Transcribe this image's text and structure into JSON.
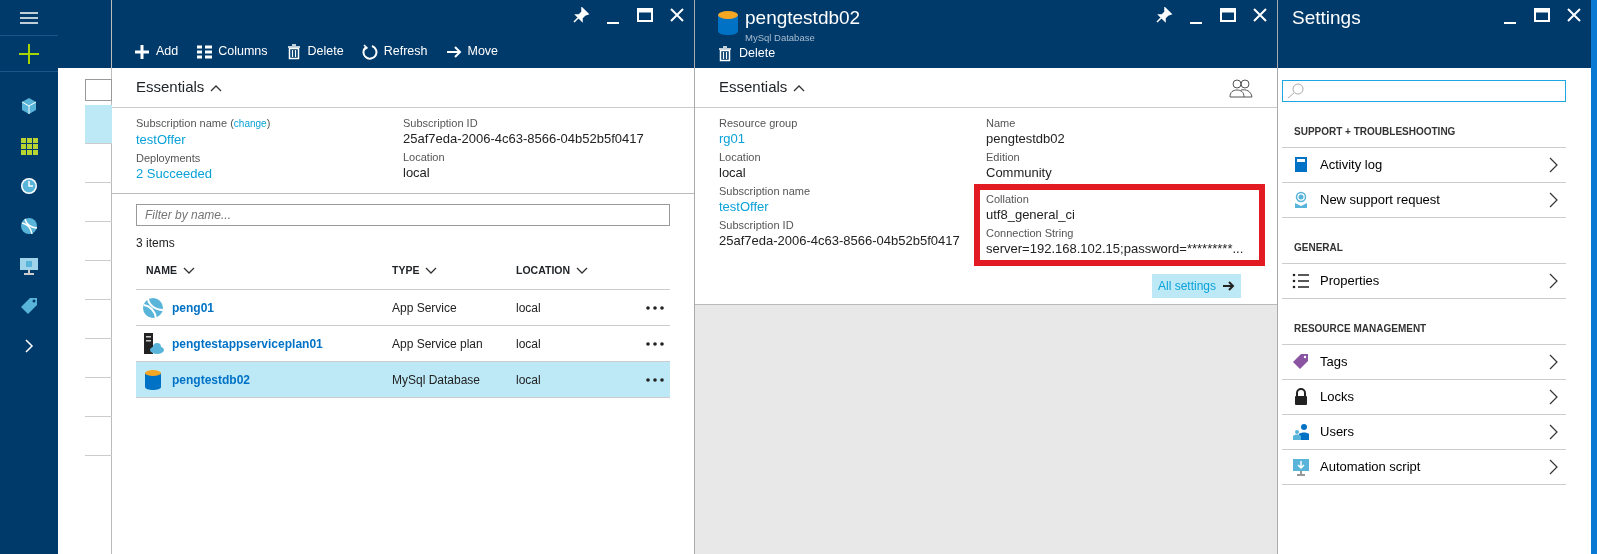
{
  "nav_sidebar": {
    "items": [
      {
        "kind": "menu"
      },
      {
        "kind": "new"
      },
      {
        "kind": "cube"
      },
      {
        "kind": "grid"
      },
      {
        "kind": "clock"
      },
      {
        "kind": "globe"
      },
      {
        "kind": "monitor"
      },
      {
        "kind": "tag"
      },
      {
        "kind": "expand"
      }
    ]
  },
  "partial_blade": {
    "rows": [
      {
        "selected": true
      },
      {
        "selected": false
      },
      {
        "selected": false
      },
      {
        "selected": false
      },
      {
        "selected": false
      },
      {
        "selected": false
      },
      {
        "selected": false
      },
      {
        "selected": false
      },
      {
        "selected": false
      }
    ]
  },
  "resource_group_blade": {
    "controls": [
      {
        "kind": "pin"
      },
      {
        "kind": "minimize"
      },
      {
        "kind": "maximize"
      },
      {
        "kind": "close"
      }
    ],
    "toolbar": [
      {
        "kind": "add",
        "label": "Add"
      },
      {
        "kind": "columns",
        "label": "Columns"
      },
      {
        "kind": "delete",
        "label": "Delete"
      },
      {
        "kind": "refresh",
        "label": "Refresh"
      },
      {
        "kind": "move",
        "label": "Move"
      }
    ],
    "essentials": {
      "title": "Essentials",
      "columns": [
        [
          {
            "label": "Subscription name (",
            "label_link": "change",
            "label_end": ")",
            "value": "testOffer",
            "is_link": true
          },
          {
            "label": "Deployments",
            "value": "2 Succeeded",
            "is_link": true
          }
        ],
        [
          {
            "label": "Subscription ID",
            "value": "25af7eda-2006-4c63-8566-04b52b5f0417",
            "is_link": false
          },
          {
            "label": "Location",
            "value": "local",
            "is_link": false
          }
        ]
      ]
    },
    "filter": {
      "placeholder": "Filter by name..."
    },
    "count": "3 items",
    "columns": [
      "NAME",
      "TYPE",
      "LOCATION"
    ],
    "rows": [
      {
        "kind": "web",
        "name": "peng01",
        "type": "App Service",
        "location": "local",
        "selected": false
      },
      {
        "kind": "plan",
        "name": "pengtestappserviceplan01",
        "type": "App Service plan",
        "location": "local",
        "selected": false
      },
      {
        "kind": "mysql",
        "name": "pengtestdb02",
        "type": "MySql Database",
        "location": "local",
        "selected": true
      }
    ]
  },
  "database_blade": {
    "title": "pengtestdb02",
    "subtitle": "MySql Database",
    "controls": [
      {
        "kind": "pin"
      },
      {
        "kind": "minimize"
      },
      {
        "kind": "maximize"
      },
      {
        "kind": "close"
      }
    ],
    "toolbar": [
      {
        "kind": "delete",
        "label": "Delete"
      }
    ],
    "essentials": {
      "title": "Essentials",
      "columns": [
        [
          {
            "label": "Resource group",
            "value": "rg01",
            "is_link": true
          },
          {
            "label": "Location",
            "value": "local",
            "is_link": false
          },
          {
            "label": "Subscription name",
            "value": "testOffer",
            "is_link": true
          },
          {
            "label": "Subscription ID",
            "value": "25af7eda-2006-4c63-8566-04b52b5f0417",
            "is_link": false
          }
        ],
        [
          {
            "label": "Name",
            "value": "pengtestdb02",
            "is_link": false
          },
          {
            "label": "Edition",
            "value": "Community",
            "is_link": false
          },
          {
            "label": "Collation",
            "value": "utf8_general_ci",
            "is_link": false,
            "highlighted": true
          },
          {
            "label": "Connection String",
            "value": "server=192.168.102.15;password=*********...",
            "is_link": false,
            "highlighted": true
          }
        ]
      ]
    },
    "all_settings": "All settings"
  },
  "settings_blade": {
    "title": "Settings",
    "controls": [
      {
        "kind": "minimize"
      },
      {
        "kind": "maximize"
      },
      {
        "kind": "close"
      }
    ],
    "sections": [
      {
        "heading": "SUPPORT + TROUBLESHOOTING",
        "items": [
          {
            "kind": "log",
            "label": "Activity log"
          },
          {
            "kind": "support",
            "label": "New support request"
          }
        ]
      },
      {
        "heading": "GENERAL",
        "items": [
          {
            "kind": "properties",
            "label": "Properties"
          }
        ]
      },
      {
        "heading": "RESOURCE MANAGEMENT",
        "items": [
          {
            "kind": "tags",
            "label": "Tags"
          },
          {
            "kind": "locks",
            "label": "Locks"
          },
          {
            "kind": "users",
            "label": "Users"
          },
          {
            "kind": "automation",
            "label": "Automation script"
          }
        ]
      }
    ]
  }
}
